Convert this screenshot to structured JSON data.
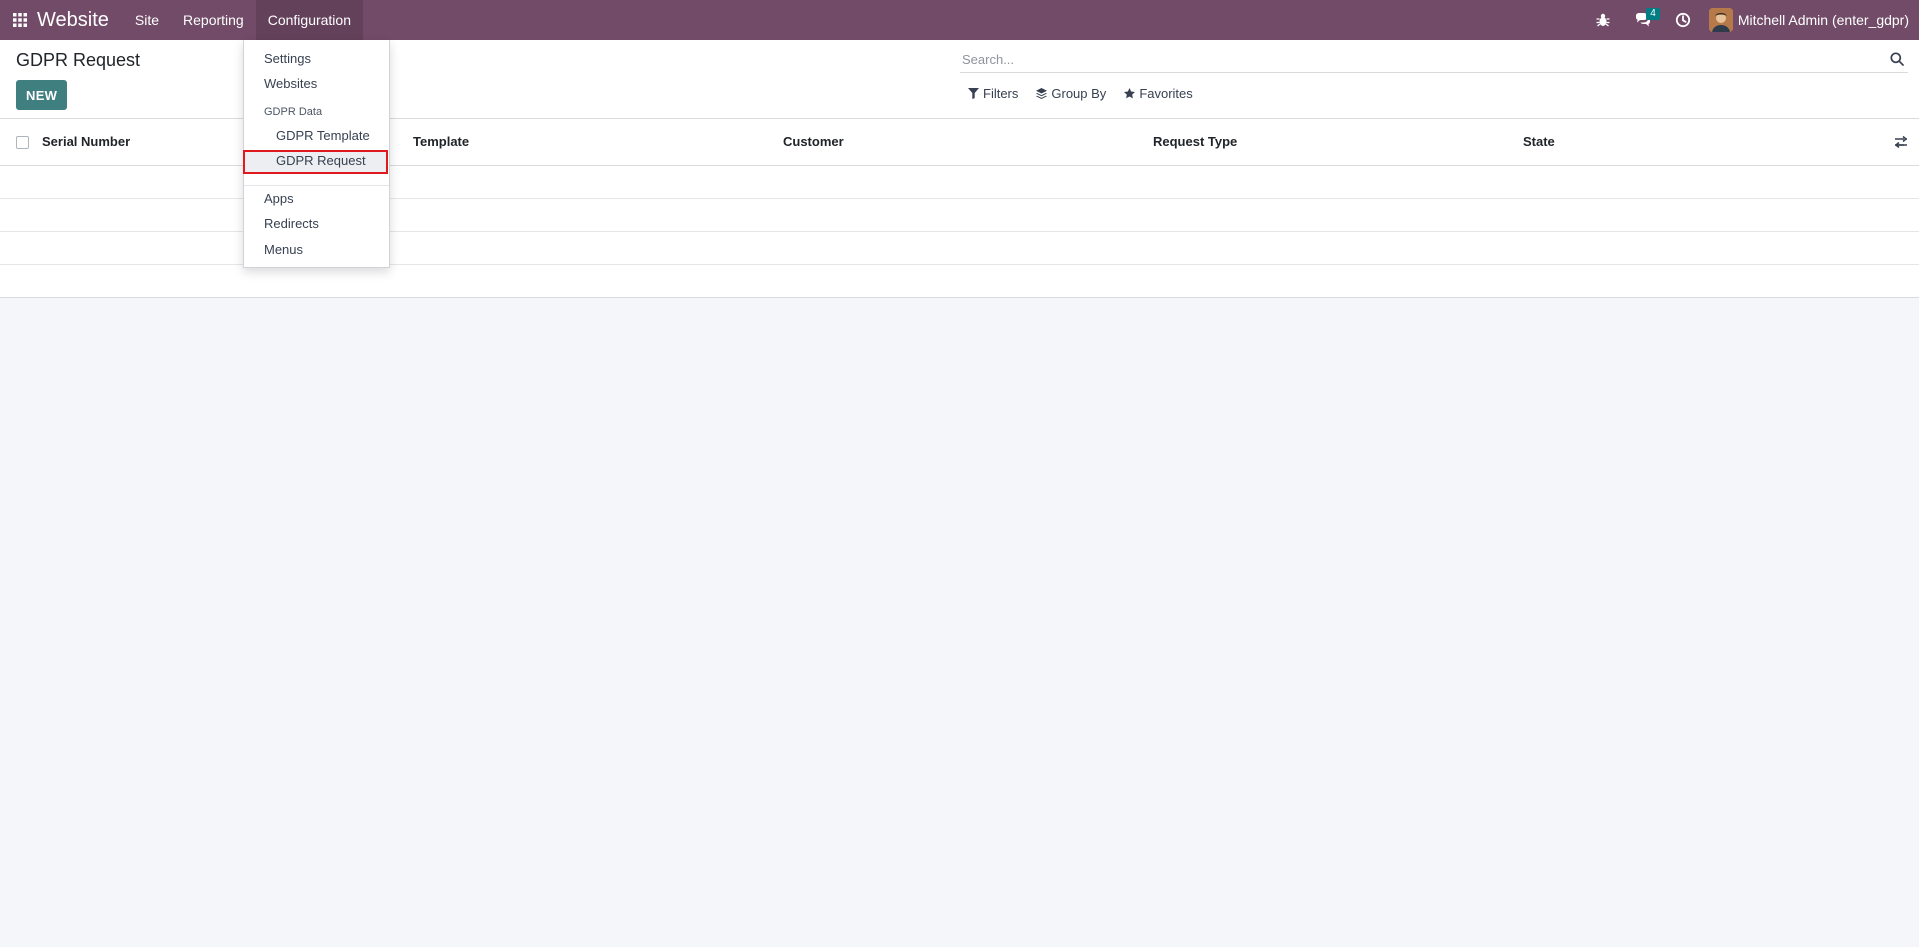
{
  "navbar": {
    "brand": "Website",
    "menus": [
      {
        "label": "Site"
      },
      {
        "label": "Reporting"
      },
      {
        "label": "Configuration"
      }
    ],
    "messages_badge": "4",
    "user_name": "Mitchell Admin (enter_gdpr)",
    "icons": [
      "apps-grid-icon",
      "bug-icon",
      "chat-icon",
      "clock-icon"
    ]
  },
  "control_panel": {
    "title": "GDPR Request",
    "new_label": "NEW",
    "search_placeholder": "Search...",
    "filters_label": "Filters",
    "group_by_label": "Group By",
    "favorites_label": "Favorites"
  },
  "list": {
    "columns": [
      "Serial Number",
      "Template",
      "Customer",
      "Request Type",
      "State"
    ],
    "rows": [
      [],
      [],
      [],
      []
    ]
  },
  "dropdown": {
    "items": [
      "Settings",
      "Websites"
    ],
    "section_header": "GDPR Data",
    "section_items": [
      "GDPR Template",
      "GDPR Request"
    ],
    "bottom_items": [
      "Apps",
      "Redirects",
      "Menus"
    ],
    "highlight_color": "#e0191f"
  },
  "colors": {
    "navbar": "#714b67",
    "primary_button": "#3f7f80",
    "badge": "#017e84"
  }
}
